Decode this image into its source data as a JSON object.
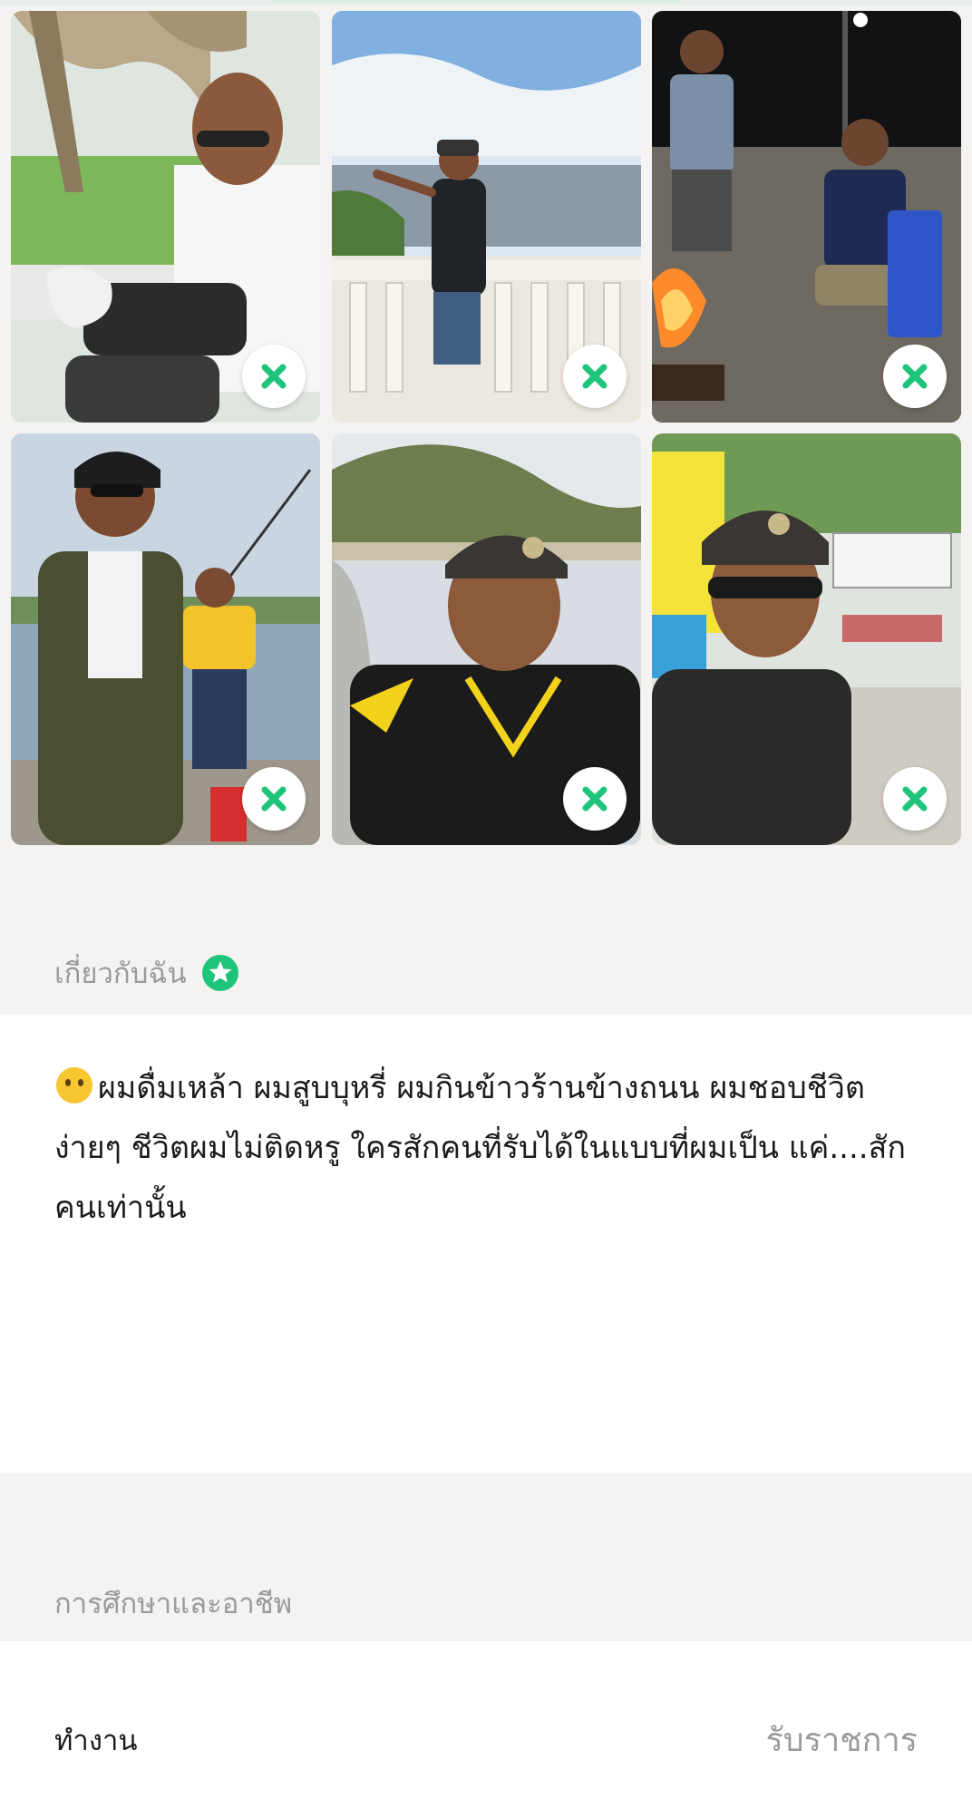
{
  "photos": [
    {
      "alt": "photo-1",
      "scene": "park"
    },
    {
      "alt": "photo-2",
      "scene": "viewpoint"
    },
    {
      "alt": "photo-3",
      "scene": "night-campfire"
    },
    {
      "alt": "photo-4",
      "scene": "fishing-pond"
    },
    {
      "alt": "photo-5",
      "scene": "dam-selfie"
    },
    {
      "alt": "photo-6",
      "scene": "station-selfie"
    }
  ],
  "about": {
    "title": "เกี่ยวกับฉัน",
    "text": "ผมดื่มเหล้า ผมสูบบุหรี่ ผมกินข้าวร้านข้างถนน ผมชอบชีวิตง่ายๆ  ชีวิตผมไม่ติดหรู ใครสักคนที่รับได้ในแบบที่ผมเป็น  แค่....สักคนเท่านั้น"
  },
  "education": {
    "title": "การศึกษาและอาชีพ"
  },
  "work": {
    "label": "ทำงาน",
    "value": "รับราชการ"
  },
  "colors": {
    "accent": "#1ec47a",
    "background": "#f4f3f1",
    "panel": "#ffffff",
    "muted_text": "#9a9a9a"
  }
}
